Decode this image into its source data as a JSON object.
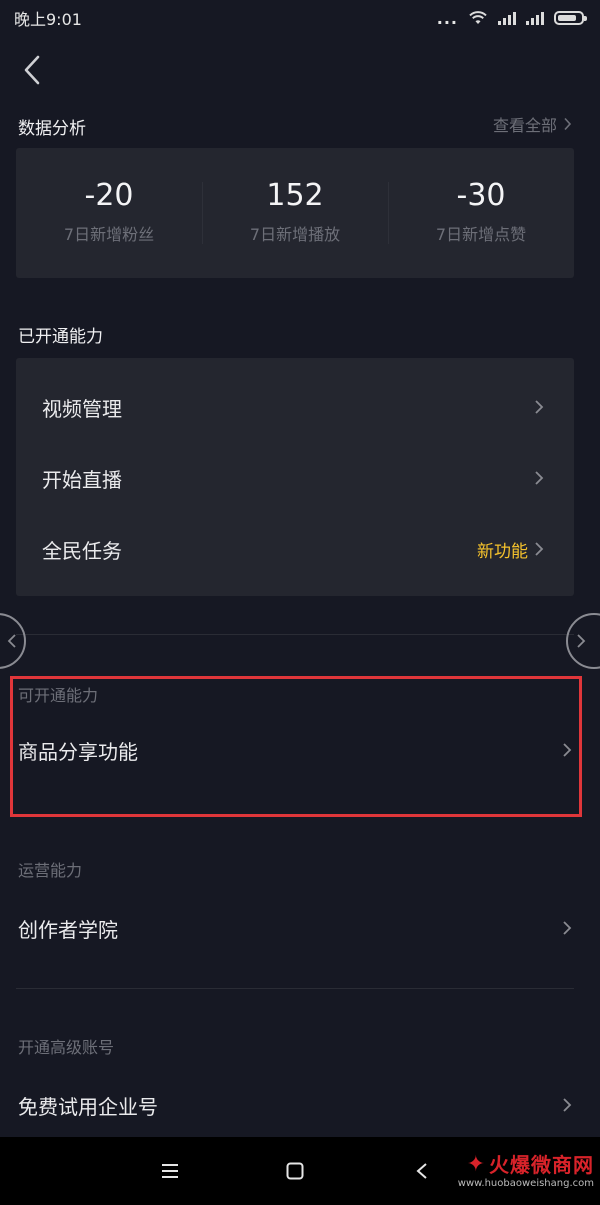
{
  "status_bar": {
    "time": "晚上9:01",
    "dots": "..."
  },
  "data_analysis": {
    "title": "数据分析",
    "view_all": "查看全部",
    "stats": [
      {
        "value": "-20",
        "label": "7日新增粉丝"
      },
      {
        "value": "152",
        "label": "7日新增播放"
      },
      {
        "value": "-30",
        "label": "7日新增点赞"
      }
    ]
  },
  "enabled": {
    "title": "已开通能力",
    "items": [
      {
        "label": "视频管理",
        "badge": ""
      },
      {
        "label": "开始直播",
        "badge": ""
      },
      {
        "label": "全民任务",
        "badge": "新功能"
      }
    ]
  },
  "available": {
    "title": "可开通能力",
    "items": [
      {
        "label": "商品分享功能"
      }
    ]
  },
  "operations": {
    "title": "运营能力",
    "items": [
      {
        "label": "创作者学院"
      }
    ]
  },
  "upgrade": {
    "title": "开通高级账号",
    "items": [
      {
        "label": "免费试用企业号"
      }
    ]
  },
  "watermark": {
    "logo_text": "火爆微商网",
    "url": "www.huobaoweishang.com"
  },
  "colors": {
    "background": "#161823",
    "card": "#24262f",
    "accent_yellow": "#f5c22c",
    "highlight_red": "#e0363a"
  },
  "icons": {
    "back": "chevron-left-icon",
    "row_arrow": "chevron-right-icon",
    "nav_menu": "menu-icon",
    "nav_home": "square-home-icon",
    "nav_back": "triangle-back-icon"
  }
}
